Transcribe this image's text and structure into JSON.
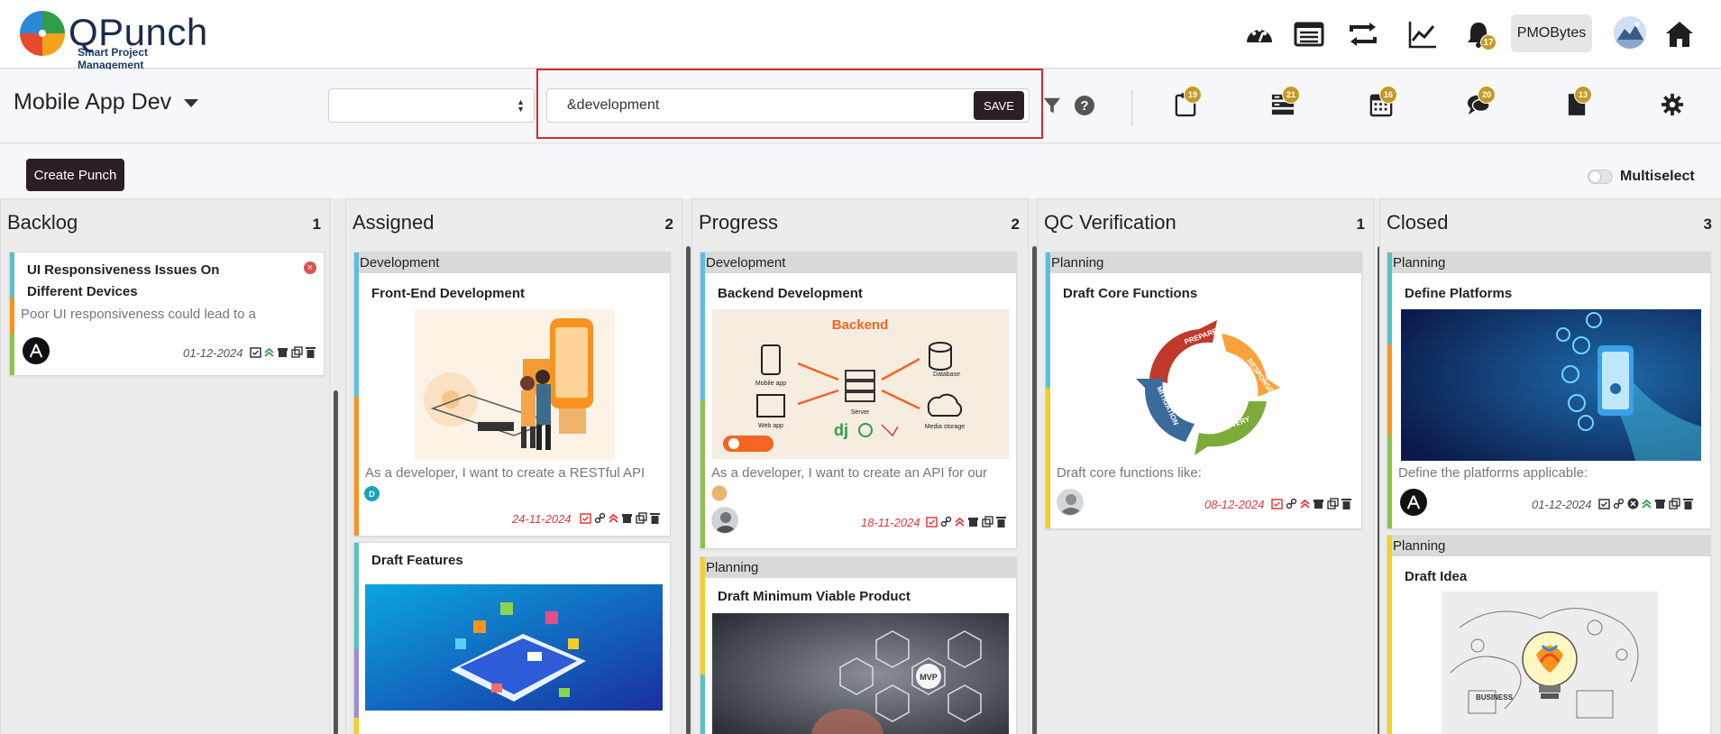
{
  "app": {
    "brand_name": "QPunch",
    "brand_tagline": "Smart Project Management",
    "org_button": "PMOBytes",
    "notification_count": "17"
  },
  "icons": {
    "top": [
      "dashboard-icon",
      "list-icon",
      "repeat-icon",
      "chart-icon",
      "bell-icon",
      "avatar",
      "home-icon"
    ],
    "sub": [
      "filter-icon",
      "help-icon",
      "clipboard-icon",
      "stack-icon",
      "calendar-icon",
      "comments-icon",
      "document-icon",
      "gear-icon"
    ]
  },
  "subheader": {
    "project_title": "Mobile App Dev",
    "select_value": "",
    "search_value": "&development",
    "save_label": "SAVE",
    "badges": {
      "clipboard": "19",
      "stack": "21",
      "calendar": "16",
      "comments": "20",
      "document": "13"
    }
  },
  "actions": {
    "create_label": "Create Punch",
    "multiselect_label": "Multiselect",
    "multiselect_on": false
  },
  "colors": {
    "accent_dark": "#2a1f26",
    "badge_gold": "#c49a27",
    "highlight_red": "#d62b2b",
    "date_red": "#e03a3a",
    "date_gray": "#555555"
  },
  "board": {
    "columns": [
      {
        "title": "Backlog",
        "count": "1",
        "cards": [
          {
            "title_line1": "UI Responsiveness Issues On",
            "title_line2": "Different Devices",
            "description": "Poor UI responsiveness could lead to a",
            "date": "01-12-2024"
          }
        ]
      },
      {
        "title": "Assigned",
        "count": "2",
        "cards": [
          {
            "group": "Development",
            "title": "Front-End Development",
            "description": "As a developer, I want to create a RESTful API",
            "assignee_initial": "D",
            "date": "24-11-2024"
          },
          {
            "title": "Draft Features"
          }
        ]
      },
      {
        "title": "Progress",
        "count": "2",
        "cards": [
          {
            "group": "Development",
            "title": "Backend Development",
            "description": "As a developer, I want to create an API for our",
            "date": "18-11-2024",
            "image_texts": {
              "heading": "Backend",
              "mobile": "Mobile app",
              "web": "Web app",
              "server": "Server",
              "database": "Database",
              "storage": "Media storage",
              "dj": "dj"
            }
          },
          {
            "group": "Planning",
            "title": "Draft Minimum Viable Product",
            "image_texts": {
              "mvp": "MVP"
            }
          }
        ]
      },
      {
        "title": "QC Verification",
        "count": "1",
        "cards": [
          {
            "group": "Planning",
            "title": "Draft Core Functions",
            "description": "Draft core functions like:",
            "date": "08-12-2024",
            "image_texts": {
              "preparedness": "PREPAREDNESS",
              "response": "RESPONSE",
              "recovery": "RECOVERY",
              "mitigation": "MITIGATION"
            }
          }
        ]
      },
      {
        "title": "Closed",
        "count": "3",
        "cards": [
          {
            "group": "Planning",
            "title": "Define Platforms",
            "description": "Define the platforms applicable:",
            "date": "01-12-2024"
          },
          {
            "group": "Planning",
            "title": "Draft Idea",
            "image_texts": {
              "business": "BUSINESS"
            }
          }
        ]
      }
    ]
  }
}
